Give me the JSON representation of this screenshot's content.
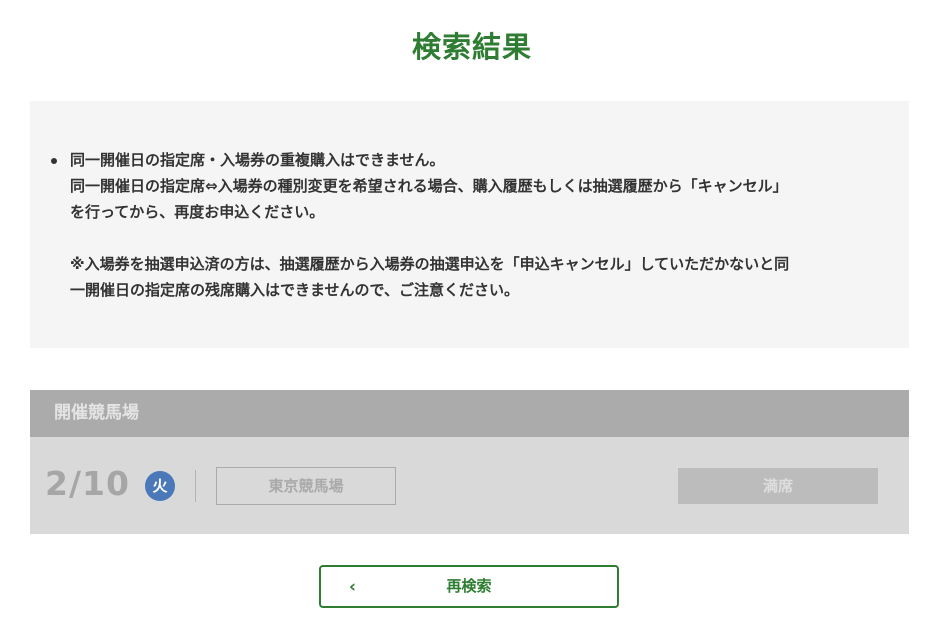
{
  "page": {
    "title": "検索結果"
  },
  "notice": {
    "line1": "同一開催日の指定席・入場券の重複購入はできません。",
    "line2": "同一開催日の指定席⇔入場券の種別変更を希望される場合、購入履歴もしくは抽選履歴から「キャンセル」",
    "line3": "を行ってから、再度お申込ください。",
    "line4": "※入場券を抽選申込済の方は、抽選履歴から入場券の抽選申込を「申込キャンセル」していただかないと同",
    "line5": "一開催日の指定席の残席購入はできませんので、ご注意ください。"
  },
  "venue_panel": {
    "header_label": "開催競馬場",
    "date": "2/10",
    "weekday": "火",
    "venue_name": "東京競馬場",
    "status": "満席"
  },
  "research_button": {
    "chevron": "‹",
    "label": "再検索"
  },
  "colors": {
    "accent_green": "#2e7d32",
    "weekday_badge_blue": "#4a78b8",
    "notice_background": "#f5f5f5",
    "panel_header": "#ababab",
    "panel_body": "#d9d9d9"
  }
}
